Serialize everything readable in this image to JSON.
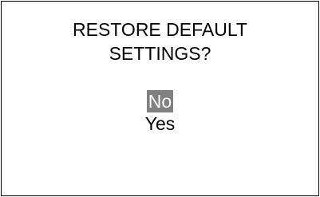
{
  "dialog": {
    "title_line1": "RESTORE DEFAULT",
    "title_line2": "SETTINGS?"
  },
  "options": [
    {
      "label": "No",
      "selected": true
    },
    {
      "label": "Yes",
      "selected": false
    }
  ],
  "colors": {
    "selected_bg": "#808080",
    "selected_fg": "#ffffff",
    "text": "#000000",
    "background": "#ffffff",
    "border": "#000000"
  }
}
